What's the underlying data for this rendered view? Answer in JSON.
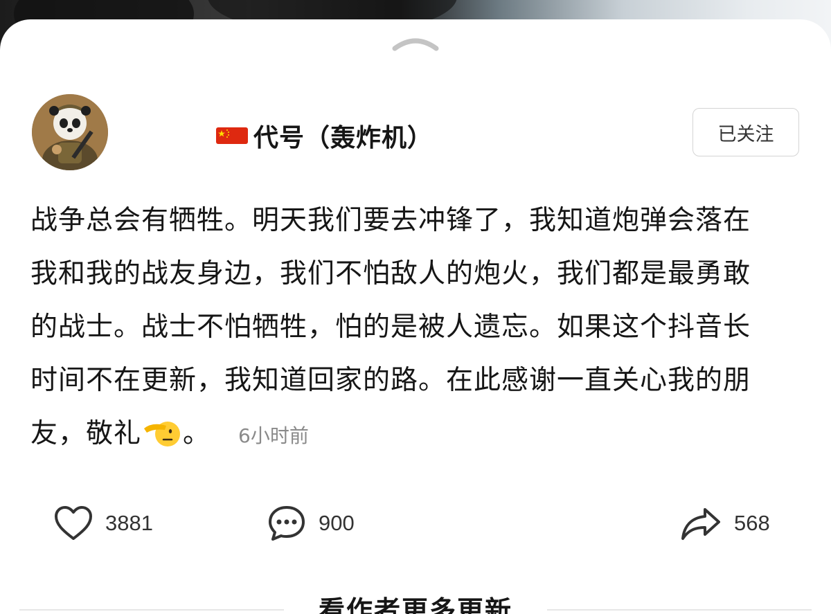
{
  "author": {
    "name": "代号（轰炸机）",
    "flag_icon": "china-flag-icon",
    "avatar_icon": "panda-soldier-avatar"
  },
  "follow_button": {
    "label": "已关注"
  },
  "post": {
    "lines": [
      "战争总会有牺牲。明天我们要去冲锋了，我知道炮弹会落在",
      "我和我的战友身边，我们不怕敌人的炮火，我们都是最勇敢",
      "的战士。战士不怕牺牲，怕的是被人遗忘。如果这个抖音长",
      "时间不在更新，我知道回家的路。在此感谢一直关心我的朋"
    ],
    "last_line_prefix": "友，敬礼",
    "last_line_emoji": "saluting-face-icon",
    "last_line_suffix": "。",
    "timestamp": "6小时前"
  },
  "actions": {
    "like": {
      "icon": "heart-icon",
      "count": "3881"
    },
    "comment": {
      "icon": "comment-bubble-icon",
      "count": "900"
    },
    "share": {
      "icon": "share-arrow-icon",
      "count": "568"
    }
  },
  "footer": {
    "more_updates_label": "看作者更多更新"
  },
  "colors": {
    "text_primary": "#161616",
    "text_secondary": "#8a8a8a",
    "flag_red": "#de2910",
    "flag_yellow": "#ffde00"
  }
}
